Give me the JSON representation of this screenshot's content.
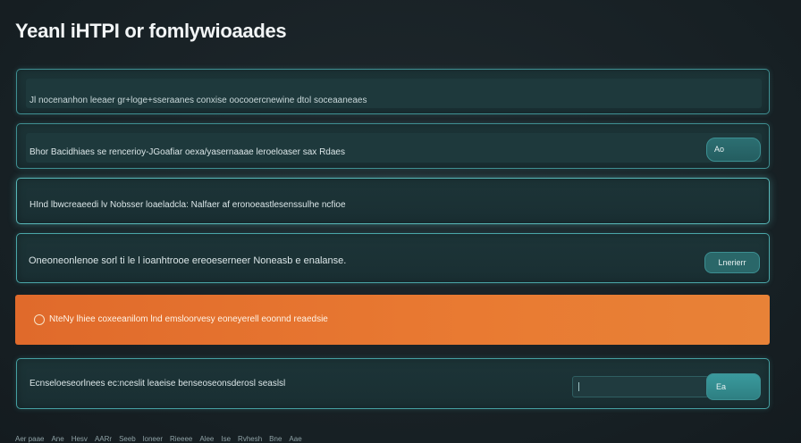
{
  "page": {
    "title": "Yeanl iHTPI or fomlywioaades"
  },
  "cards": [
    {
      "text": "Jl nocenanhon leeaer gr+loge+sseraanes conxise oocooercnewine dtol soceaaneaes"
    },
    {
      "text": "Bhor Bacidhiaes se rencerioy-JGoafiar oexa/yasernaaae leroeloaser sax Rdaes",
      "button_label": "Ao"
    },
    {
      "text": "HInd lbwcreaeedi lv Nobsser loaeladcla: Nalfaer af eronoeastlesenssulhe ncfioe"
    },
    {
      "text": "Oneoneonlenoe sorl ti le l ioanhtrooe ereoeserneer Noneasb e enalanse.",
      "button_label": "Lnerierr"
    },
    {
      "text": "Ecnseloeseorlnees  ec:nceslit  leaeise benseoseonsderosl seaslsl",
      "input_value": "",
      "button_label": "Ea"
    }
  ],
  "alert": {
    "text": "NteNy lhiee coxeeanilom lnd emsloorvesy eoneyerell eoonnd reaedsie",
    "icon": "warning-icon"
  },
  "footer": {
    "items": [
      "Aer paae",
      "Ane",
      "Hesv",
      "AARr",
      "Seeb",
      "loneer",
      "Rieeee",
      "Alee",
      "Ise",
      "Rvhesh",
      "Bne",
      "Aae"
    ]
  },
  "colors": {
    "accent": "#3f8f92",
    "alert": "#e06a2b",
    "background": "#1a2126"
  }
}
